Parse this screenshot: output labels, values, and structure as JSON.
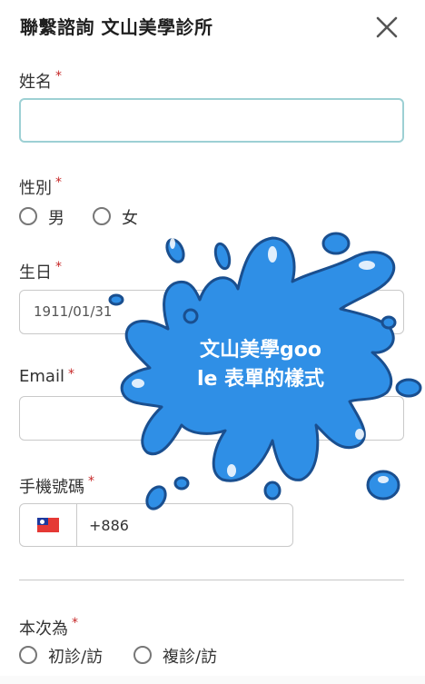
{
  "header": {
    "title": "聯繫諮詢 文山美學診所",
    "close_icon": "close-icon"
  },
  "form": {
    "name": {
      "label": "姓名",
      "required_mark": "*",
      "value": ""
    },
    "gender": {
      "label": "性別",
      "required_mark": "*",
      "options": [
        "男",
        "女"
      ],
      "selected": null
    },
    "birthday": {
      "label": "生日",
      "required_mark": "*",
      "value": "1911/01/31"
    },
    "email": {
      "label": "Email",
      "required_mark": "*",
      "value": ""
    },
    "phone": {
      "label": "手機號碼",
      "required_mark": "*",
      "country_flag": "taiwan-flag-icon",
      "dial_code": "+886"
    },
    "visit_type": {
      "label": "本次為",
      "required_mark": "*",
      "options": [
        "初診/訪",
        "複診/訪"
      ],
      "selected": null
    }
  },
  "overlay": {
    "line1": "文山美學goo",
    "line2": "le 表單的樣式",
    "color": "#2f8fe6"
  },
  "colors": {
    "required": "#c62828",
    "focus_border": "#9dd0d4",
    "splash_blue": "#2f8fe6"
  }
}
